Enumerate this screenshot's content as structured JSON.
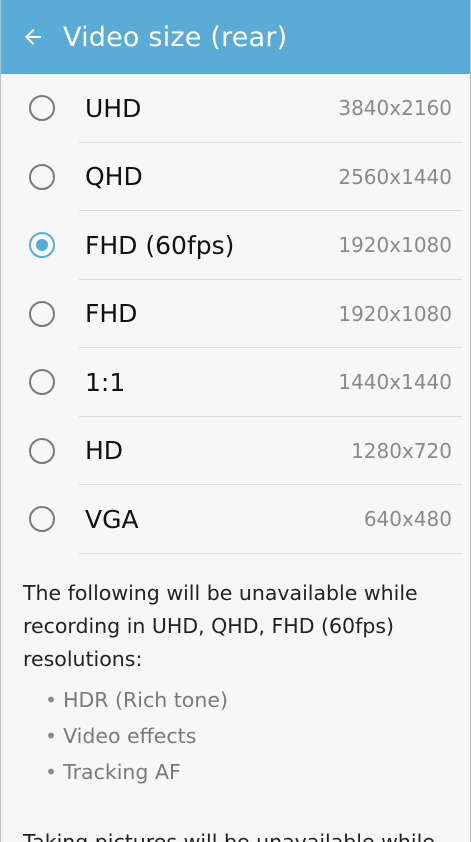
{
  "app_bar": {
    "title": "Video size (rear)",
    "back_icon": "arrow-left-icon"
  },
  "options": [
    {
      "label": "UHD",
      "value": "3840x2160",
      "selected": false
    },
    {
      "label": "QHD",
      "value": "2560x1440",
      "selected": false
    },
    {
      "label": "FHD (60fps)",
      "value": "1920x1080",
      "selected": true
    },
    {
      "label": "FHD",
      "value": "1920x1080",
      "selected": false
    },
    {
      "label": "1:1",
      "value": "1440x1440",
      "selected": false
    },
    {
      "label": "HD",
      "value": "1280x720",
      "selected": false
    },
    {
      "label": "VGA",
      "value": "640x480",
      "selected": false
    }
  ],
  "note": {
    "text": "The following will be unavailable while recording in UHD, QHD, FHD (60fps) resolutions:",
    "bullets": [
      "HDR (Rich tone)",
      "Video effects",
      "Tracking AF"
    ],
    "text2": "Taking pictures will be unavailable while"
  },
  "colors": {
    "accent": "#5aabd6",
    "app_bar": "#5aabd6"
  }
}
